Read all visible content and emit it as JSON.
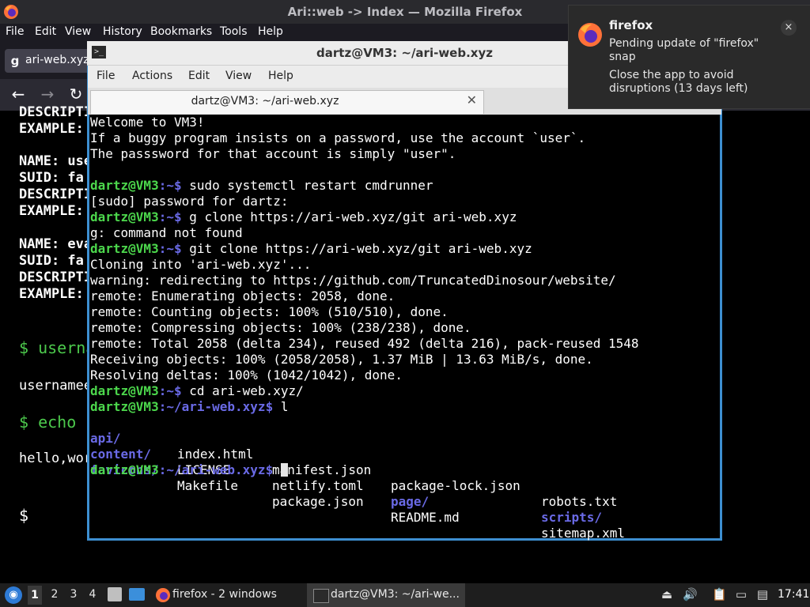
{
  "firefox": {
    "window_title": "Ari::web -> Index — Mozilla Firefox",
    "menu": [
      "File",
      "Edit",
      "View",
      "History",
      "Bookmarks",
      "Tools",
      "Help"
    ],
    "tab_label": "ari-web.xyz",
    "content_lines": [
      "DESCRIPTI",
      "EXAMPLE:",
      "NAME: use",
      "SUID: fa",
      "DESCRIPTI",
      "EXAMPLE:",
      "NAME: eva",
      "SUID: fa",
      "DESCRIPTI",
      "EXAMPLE:",
      "$ userna",
      "usernamee",
      "$ echo",
      "hello,wor",
      "$"
    ]
  },
  "terminal": {
    "window_title": "dartz@VM3: ~/ari-web.xyz",
    "menu": [
      "File",
      "Actions",
      "Edit",
      "View",
      "Help"
    ],
    "tab_label": "dartz@VM3: ~/ari-web.xyz",
    "tab_close": "✕",
    "prompt_user": "dartz@VM3",
    "lines": {
      "l1": "Welcome to VM3!",
      "l2": "If a buggy program insists on a password, use the account `user`.",
      "l3": "The passsword for that account is simply \"user\".",
      "c1_path": ":~$",
      "c1_cmd": " sudo systemctl restart cmdrunner",
      "l5": "[sudo] password for dartz:",
      "c2_path": ":~$",
      "c2_cmd": " g clone https://ari-web.xyz/git ari-web.xyz",
      "l7": "g: command not found",
      "c3_path": ":~$",
      "c3_cmd": " git clone https://ari-web.xyz/git ari-web.xyz",
      "l9": "Cloning into 'ari-web.xyz'...",
      "l10": "warning: redirecting to https://github.com/TruncatedDinosour/website/",
      "l11": "remote: Enumerating objects: 2058, done.",
      "l12": "remote: Counting objects: 100% (510/510), done.",
      "l13": "remote: Compressing objects: 100% (238/238), done.",
      "l14": "remote: Total 2058 (delta 234), reused 492 (delta 216), pack-reused 1548",
      "l15": "Receiving objects: 100% (2058/2058), 1.37 MiB | 13.63 MiB/s, done.",
      "l16": "Resolving deltas: 100% (1042/1042), done.",
      "c4_path": ":~$",
      "c4_cmd": " cd ari-web.xyz/",
      "c5_path": ":~/ari-web.xyz$",
      "c5_cmd": " l",
      "c6_path": ":~/ari-web.xyz$"
    },
    "ls": {
      "r1": [
        "api/",
        "index.html",
        "manifest.json",
        "package-lock.json",
        "robots.txt"
      ],
      "r2": [
        "content/",
        "LICENSE",
        "netlify.toml",
        "page/",
        "scripts/"
      ],
      "r3": [
        "favicons/",
        "Makefile",
        "package.json",
        "README.md",
        "sitemap.xml"
      ]
    }
  },
  "notification": {
    "app": "firefox",
    "summary": "Pending update of \"firefox\" snap",
    "body": "Close the app to avoid disruptions (13 days left)",
    "close": "×"
  },
  "taskbar": {
    "workspaces": [
      "1",
      "2",
      "3",
      "4"
    ],
    "task1": "firefox - 2 windows",
    "task2": "dartz@VM3: ~/ari-we...",
    "clock": "17:41"
  },
  "colors": {
    "terminal_border": "#3d8fd1",
    "prompt_user": "#4cd74c",
    "prompt_path": "#6a6ae6",
    "directory": "#6a6ae6"
  }
}
